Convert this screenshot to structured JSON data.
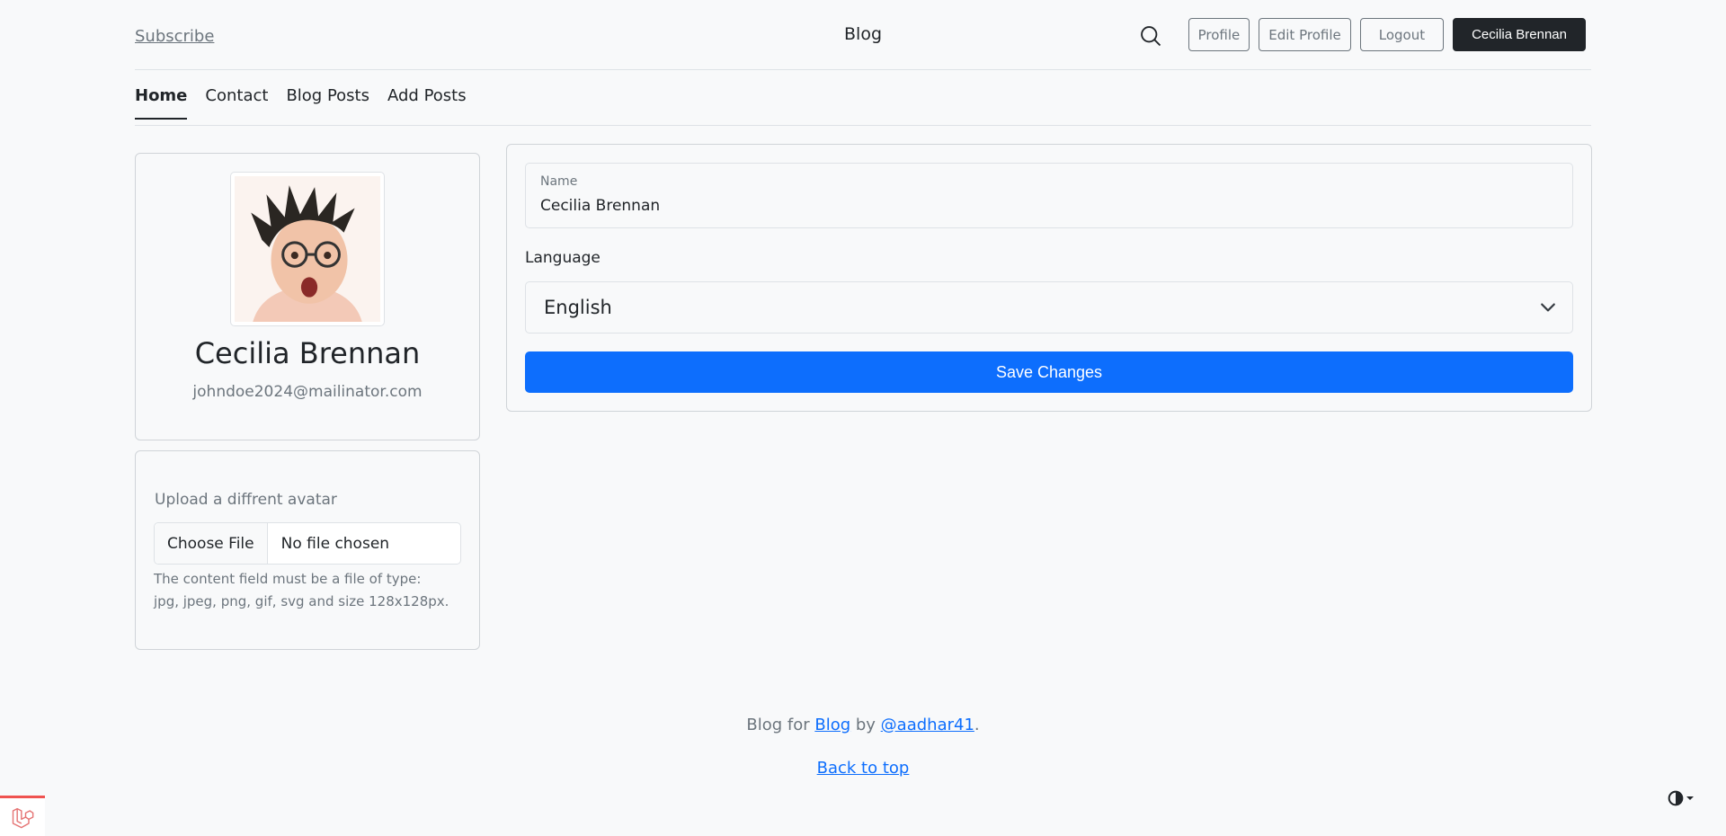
{
  "header": {
    "subscribe_label": "Subscribe",
    "brand": "Blog",
    "profile_label": "Profile",
    "edit_profile_label": "Edit Profile",
    "logout_label": "Logout",
    "user_button_label": "Cecilia Brennan"
  },
  "nav": {
    "items": [
      {
        "label": "Home",
        "active": true
      },
      {
        "label": "Contact"
      },
      {
        "label": "Blog Posts"
      },
      {
        "label": "Add Posts"
      }
    ]
  },
  "profile": {
    "name": "Cecilia Brennan",
    "email": "johndoe2024@mailinator.com"
  },
  "upload": {
    "label": "Upload a diffrent avatar",
    "choose_file_label": "Choose File",
    "file_status": "No file chosen",
    "help_text": "The content field must be a file of type: jpg, jpeg, png, gif, svg and size 128x128px."
  },
  "form": {
    "name_label": "Name",
    "name_value": "Cecilia Brennan",
    "language_label": "Language",
    "language_value": "English",
    "save_label": "Save Changes"
  },
  "footer": {
    "prefix": "Blog for ",
    "blog_link": "Blog",
    "by": " by ",
    "author_link": "@aadhar41",
    "suffix": ".",
    "back_to_top": "Back to top"
  },
  "colors": {
    "accent": "#0d6efd",
    "dark": "#212529",
    "muted": "#6c757d",
    "background": "#f8f9fa"
  },
  "icons": {
    "search": "search-icon",
    "chevron": "chevron-down-icon",
    "theme": "contrast-icon",
    "debug": "laravel-icon"
  }
}
